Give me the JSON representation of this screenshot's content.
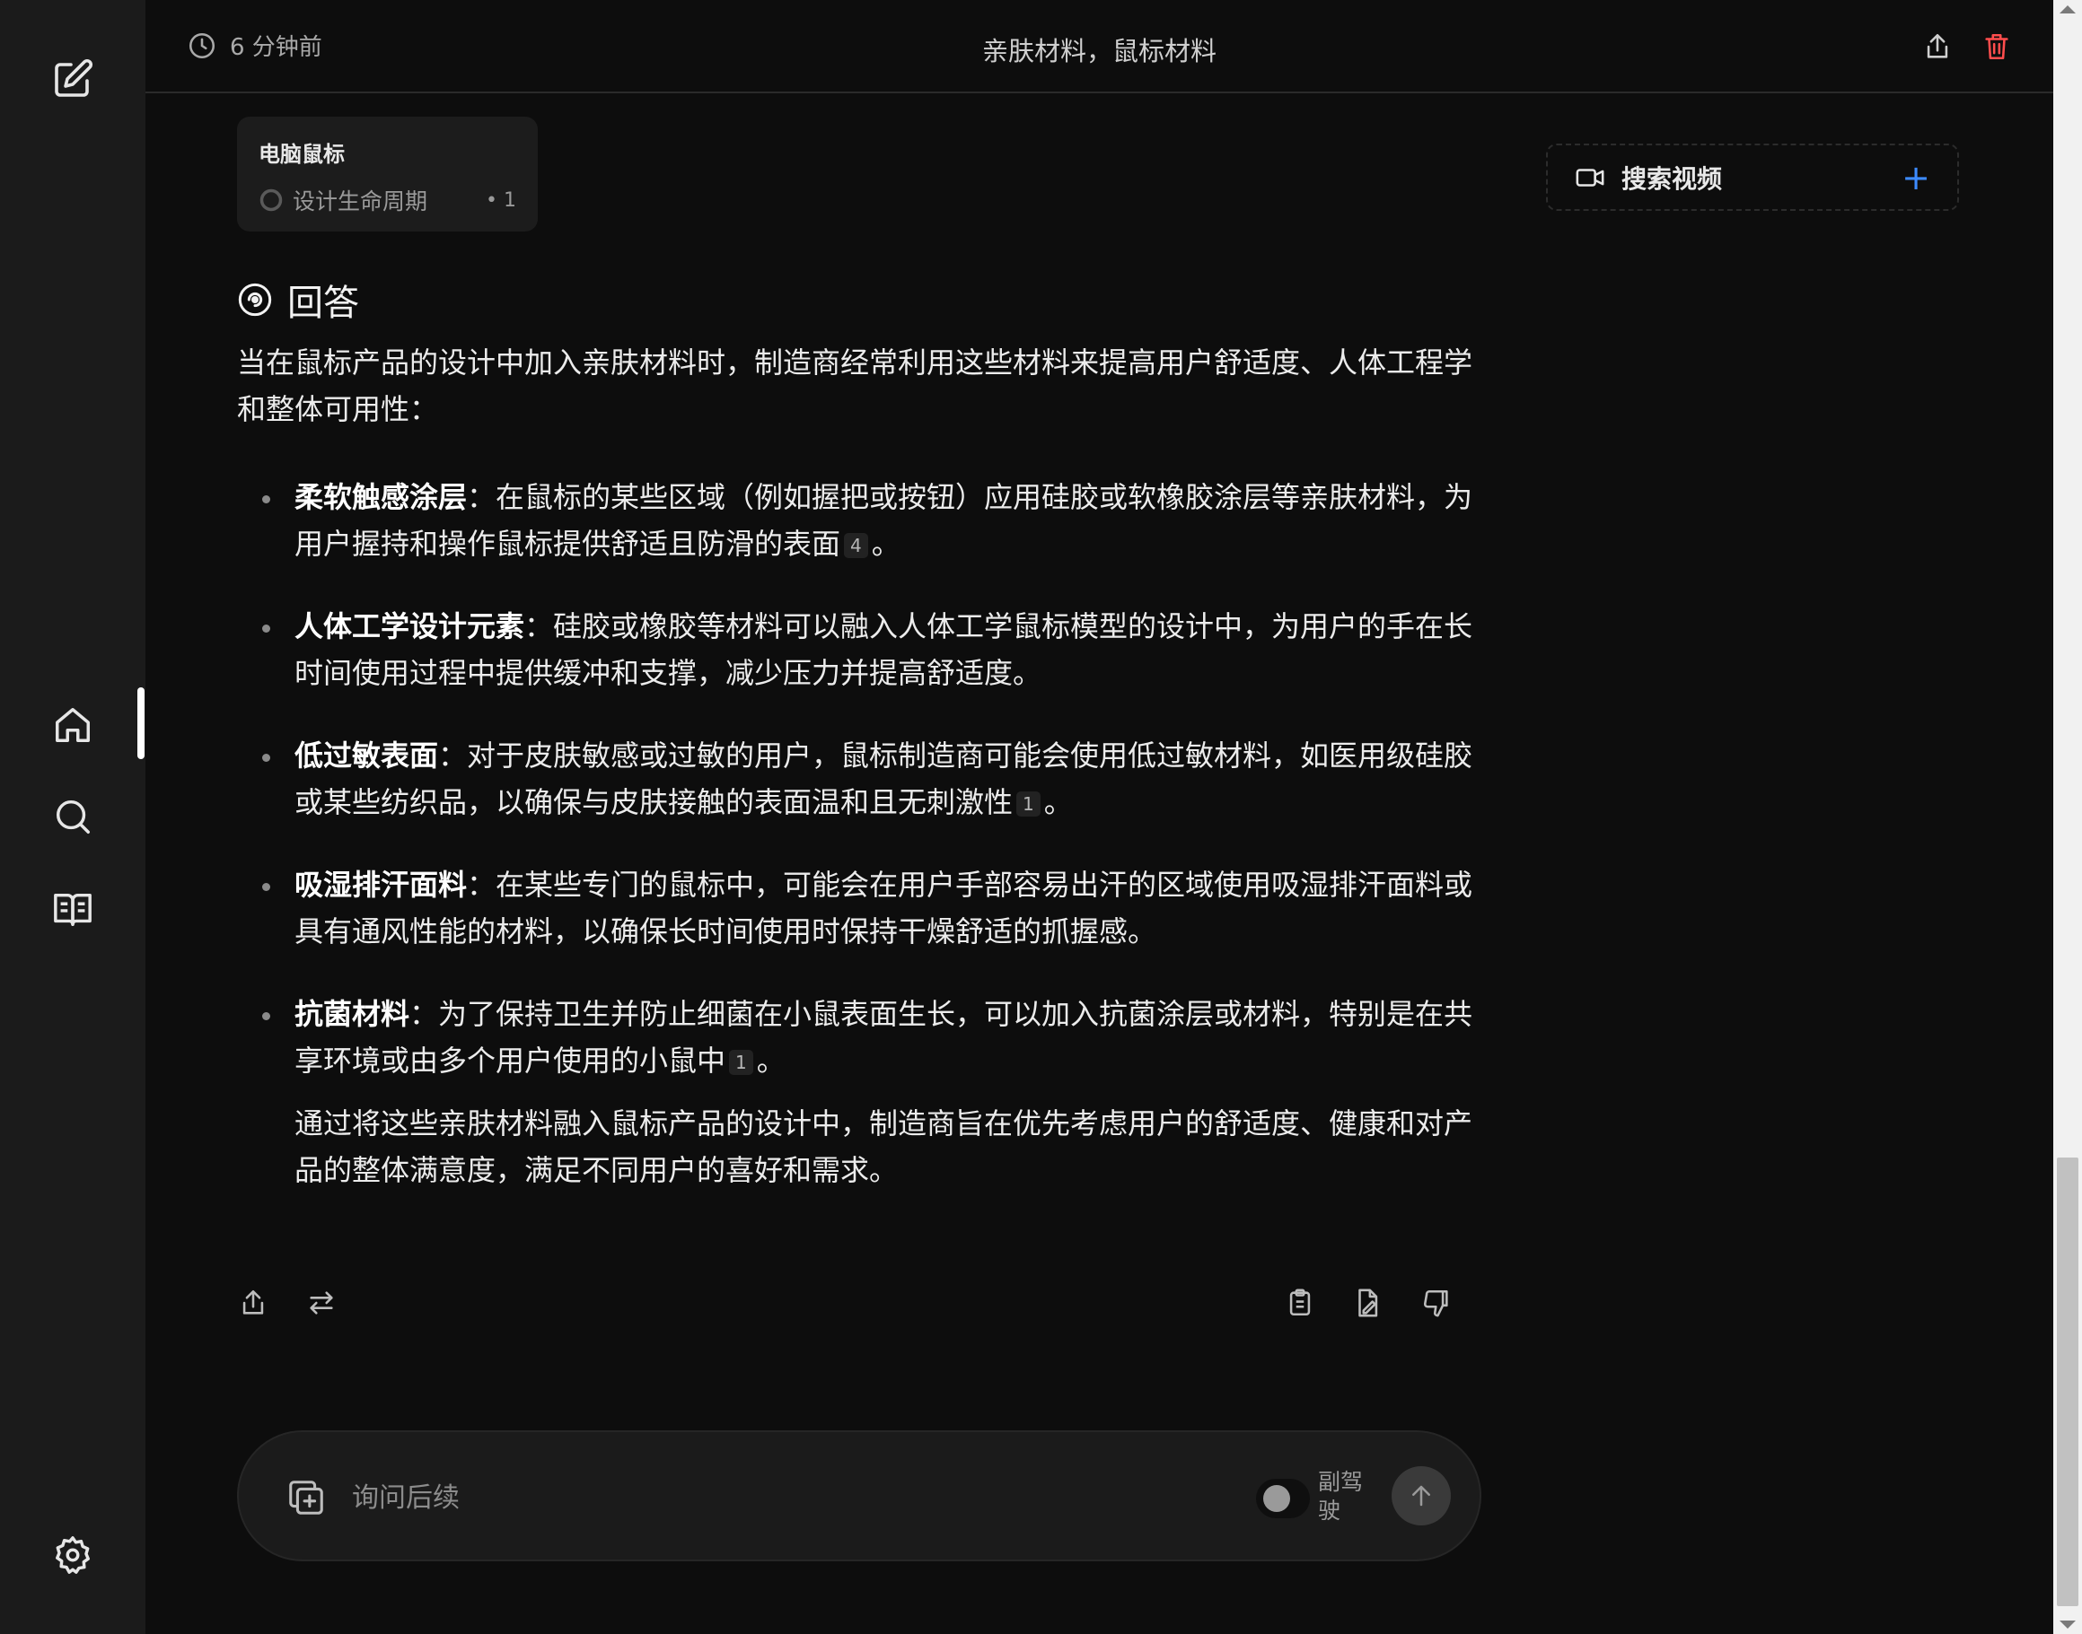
{
  "header": {
    "time": "6 分钟前",
    "title": "亲肤材料，鼠标材料"
  },
  "source_card": {
    "title": "电脑鼠标",
    "item": "设计生命周期",
    "count": "• 1"
  },
  "video": {
    "label": "搜索视频",
    "add": "+"
  },
  "answer": {
    "heading": "回答",
    "intro": "当在鼠标产品的设计中加入亲肤材料时，制造商经常利用这些材料来提高用户舒适度、人体工程学和整体可用性：",
    "bullets": [
      {
        "title": "柔软触感涂层",
        "text": "：在鼠标的某些区域（例如握把或按钮）应用硅胶或软橡胶涂层等亲肤材料，为用户握持和操作鼠标提供舒适且防滑的表面",
        "cite": "4",
        "end": "。"
      },
      {
        "title": "人体工学设计元素",
        "text": "：硅胶或橡胶等材料可以融入人体工学鼠标模型的设计中，为用户的手在长时间使用过程中提供缓冲和支撑，减少压力并提高舒适度。",
        "cite": "",
        "end": ""
      },
      {
        "title": "低过敏表面",
        "text": "：对于皮肤敏感或过敏的用户，鼠标制造商可能会使用低过敏材料，如医用级硅胶或某些纺织品，以确保与皮肤接触的表面温和且无刺激性",
        "cite": "1",
        "end": "。"
      },
      {
        "title": "吸湿排汗面料",
        "text": "：在某些专门的鼠标中，可能会在用户手部容易出汗的区域使用吸湿排汗面料或具有通风性能的材料，以确保长时间使用时保持干燥舒适的抓握感。",
        "cite": "",
        "end": ""
      },
      {
        "title": "抗菌材料",
        "text": "：为了保持卫生并防止细菌在小鼠表面生长，可以加入抗菌涂层或材料，特别是在共享环境或由多个用户使用的小鼠中",
        "cite": "1",
        "end": "。"
      }
    ],
    "summary": "通过将这些亲肤材料融入鼠标产品的设计中，制造商旨在优先考虑用户的舒适度、健康和对产品的整体满意度，满足不同用户的喜好和需求。"
  },
  "input": {
    "placeholder": "询问后续",
    "copilot_label": "副驾驶"
  },
  "colors": {
    "accent": "#3d8bff",
    "delete": "#ff4d4d",
    "background": "#0d0d0d",
    "sidebar": "#1b1b1b"
  },
  "icons": {
    "sidebar": [
      "new-thread-icon",
      "home-icon",
      "search-icon",
      "library-icon",
      "settings-icon"
    ],
    "actions_left": [
      "share-icon",
      "rewrite-icon"
    ],
    "actions_right": [
      "copy-icon",
      "edit-icon",
      "thumbs-down-icon"
    ]
  }
}
